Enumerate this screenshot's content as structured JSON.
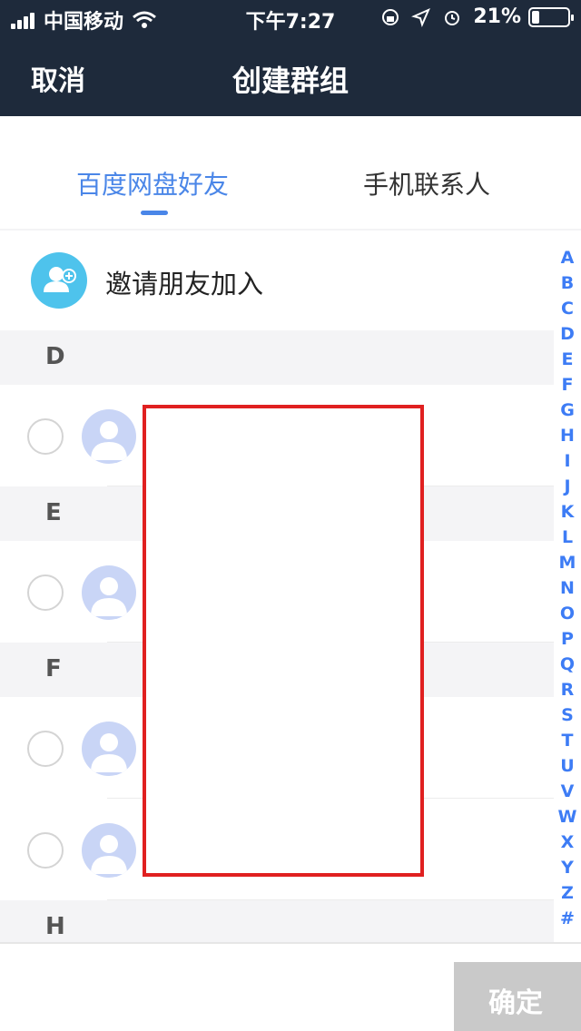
{
  "status_bar": {
    "carrier": "中国移动",
    "time": "下午7:27",
    "battery": "21%",
    "battery_level": 0.21
  },
  "nav": {
    "cancel": "取消",
    "title": "创建群组"
  },
  "tabs": [
    {
      "label": "百度网盘好友",
      "active": true
    },
    {
      "label": "手机联系人",
      "active": false
    }
  ],
  "invite": {
    "label": "邀请朋友加入",
    "icon": "add-friend-icon"
  },
  "sections": [
    {
      "letter": "D"
    },
    {
      "letter": "E"
    },
    {
      "letter": "F"
    },
    {
      "letter": "H"
    }
  ],
  "index_letters": [
    "A",
    "B",
    "C",
    "D",
    "E",
    "F",
    "G",
    "H",
    "I",
    "J",
    "K",
    "L",
    "M",
    "N",
    "O",
    "P",
    "Q",
    "R",
    "S",
    "T",
    "U",
    "V",
    "W",
    "X",
    "Y",
    "Z",
    "#"
  ],
  "footer": {
    "confirm": "确定"
  },
  "colors": {
    "header_bg": "#1e2a3b",
    "accent": "#4a86e8",
    "index": "#3d7cf5",
    "redaction_border": "#e02020"
  }
}
